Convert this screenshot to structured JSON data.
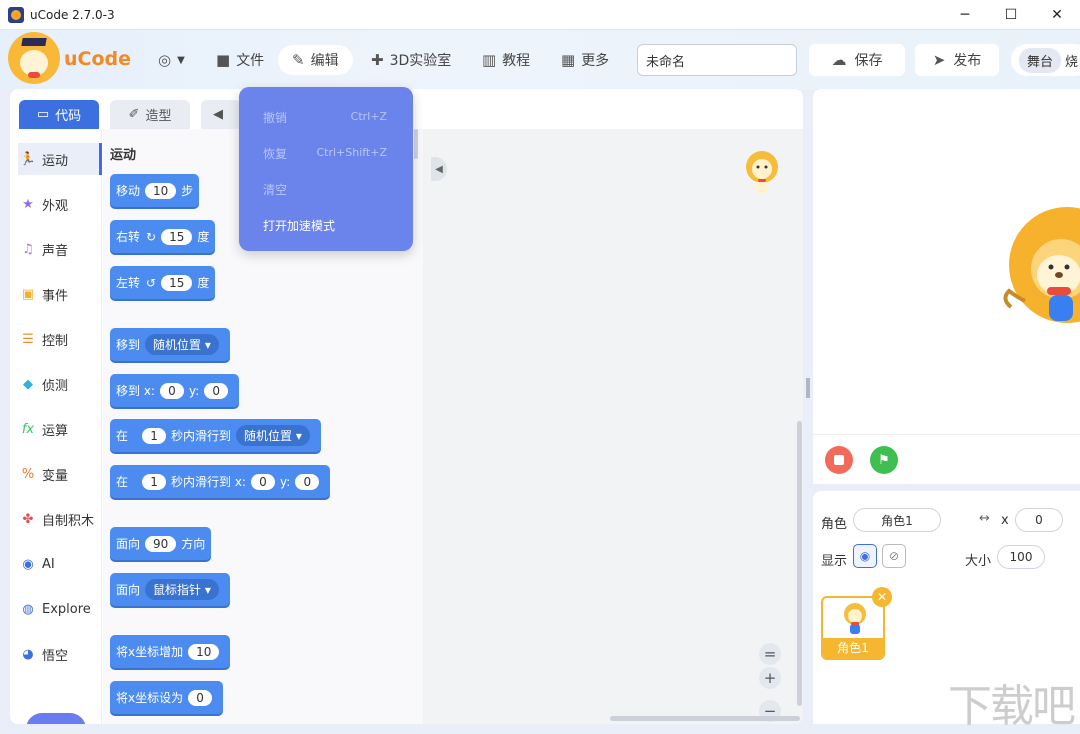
{
  "window": {
    "title": "uCode 2.7.0-3",
    "controls": {
      "minimize": "─",
      "maximize": "☐",
      "close": "✕"
    }
  },
  "header": {
    "brand": "uCode",
    "menus": [
      {
        "label": "",
        "icon": "globe-icon"
      },
      {
        "label": "文件",
        "icon": "folder-icon"
      },
      {
        "label": "编辑",
        "icon": "pencil-icon"
      },
      {
        "label": "3D实验室",
        "icon": "puzzle-icon"
      },
      {
        "label": "教程",
        "icon": "book-icon"
      },
      {
        "label": "更多",
        "icon": "grid-icon"
      }
    ],
    "project_name": "未命名",
    "save_label": "保存",
    "publish_label": "发布",
    "stage_label": "舞台",
    "stage_extra": "烧"
  },
  "edit_menu": {
    "items": [
      {
        "label": "撤销",
        "shortcut": "Ctrl+Z",
        "enabled": false
      },
      {
        "label": "恢复",
        "shortcut": "Ctrl+Shift+Z",
        "enabled": false
      },
      {
        "label": "清空",
        "shortcut": "",
        "enabled": false
      },
      {
        "label": "打开加速模式",
        "shortcut": "",
        "enabled": true
      }
    ]
  },
  "tabs": [
    {
      "label": "代码",
      "active": true
    },
    {
      "label": "造型",
      "active": false
    },
    {
      "label": "",
      "active": false
    }
  ],
  "categories": [
    {
      "label": "运动",
      "icon": "run-icon",
      "color": "#3c6fe0"
    },
    {
      "label": "外观",
      "icon": "star-icon",
      "color": "#8e6ef0"
    },
    {
      "label": "声音",
      "icon": "sound-icon",
      "color": "#c270e0"
    },
    {
      "label": "事件",
      "icon": "calendar-icon",
      "color": "#f0b030"
    },
    {
      "label": "控制",
      "icon": "sliders-icon",
      "color": "#f08c30"
    },
    {
      "label": "侦测",
      "icon": "sense-icon",
      "color": "#30b0e0"
    },
    {
      "label": "运算",
      "icon": "fx-icon",
      "color": "#40c060"
    },
    {
      "label": "变量",
      "icon": "variable-icon",
      "color": "#f07830"
    },
    {
      "label": "自制积木",
      "icon": "custom-block-icon",
      "color": "#e05050"
    },
    {
      "label": "AI",
      "icon": "ai-icon",
      "color": "#3c6fe0"
    },
    {
      "label": "Explore",
      "icon": "explore-icon",
      "color": "#3c6fe0"
    },
    {
      "label": "悟空",
      "icon": "robot-icon",
      "color": "#3c6fe0"
    }
  ],
  "palette": {
    "section": "运动",
    "blocks": {
      "move": {
        "pre": "移动",
        "val": "10",
        "post": "步"
      },
      "turn_right": {
        "pre": "右转",
        "val": "15",
        "post": "度"
      },
      "turn_left": {
        "pre": "左转",
        "val": "15",
        "post": "度"
      },
      "goto": {
        "pre": "移到",
        "dd": "随机位置"
      },
      "goto_xy": {
        "pre": "移到 x:",
        "x": "0",
        "ylabel": "y:",
        "y": "0"
      },
      "glide": {
        "pre": "在",
        "val": "1",
        "mid": "秒内滑行到",
        "dd": "随机位置"
      },
      "glide_xy": {
        "pre": "在",
        "val": "1",
        "mid": "秒内滑行到 x:",
        "x": "0",
        "ylabel": "y:",
        "y": "0"
      },
      "point": {
        "pre": "面向",
        "val": "90",
        "post": "方向"
      },
      "point_to": {
        "pre": "面向",
        "dd": "鼠标指针"
      },
      "change_x": {
        "pre": "将x坐标增加",
        "val": "10"
      },
      "set_x": {
        "pre": "将x坐标设为",
        "val": "0"
      }
    }
  },
  "workspace": {
    "zoom_in": "+",
    "zoom_out": "−",
    "zoom_reset": "="
  },
  "sprite_panel": {
    "sprite_label": "角色",
    "sprite_name": "角色1",
    "x_label": "x",
    "x_value": "0",
    "show_label": "显示",
    "size_label": "大小",
    "size_value": "100",
    "card_name": "角色1"
  },
  "colors": {
    "accent": "#3c6fe0",
    "block": "#4c8cf0",
    "sprite_card": "#f5b630",
    "menu_popup": "#6b84ec"
  }
}
